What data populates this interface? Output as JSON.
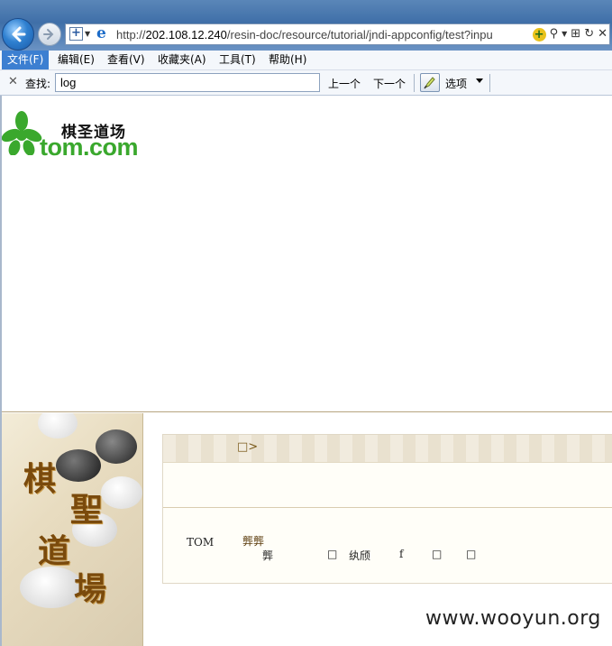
{
  "browser": {
    "url_prefix": "http://",
    "url_host": "202.108.12.240",
    "url_path": "/resin-doc/resource/tutorial/jndi-appconfig/test?inpu"
  },
  "menu": [
    {
      "label": "文件(F)",
      "active": true
    },
    {
      "label": "编辑(E)",
      "active": false
    },
    {
      "label": "查看(V)",
      "active": false
    },
    {
      "label": "收藏夹(A)",
      "active": false
    },
    {
      "label": "工具(T)",
      "active": false
    },
    {
      "label": "帮助(H)",
      "active": false
    }
  ],
  "find": {
    "label": "查找:",
    "value": "log",
    "prev_label": "上一个",
    "next_label": "下一个",
    "options_label": "选项"
  },
  "logo": {
    "cn": "棋圣道场",
    "en": "tom.com"
  },
  "go_panel": {
    "chars": [
      "棋",
      "聖",
      "道",
      "場"
    ]
  },
  "content": {
    "head_text": "□>",
    "head_right": "",
    "row1": [
      "TOM",
      "龏龏"
    ],
    "row2": [
      "龏",
      "□",
      "纨颀",
      "f",
      "□",
      "□"
    ]
  },
  "watermark": "www.wooyun.org",
  "colors": {
    "menu_active": "#3c7fd1",
    "logo_green": "#3aa82d",
    "go_text": "#7a4a0c"
  }
}
